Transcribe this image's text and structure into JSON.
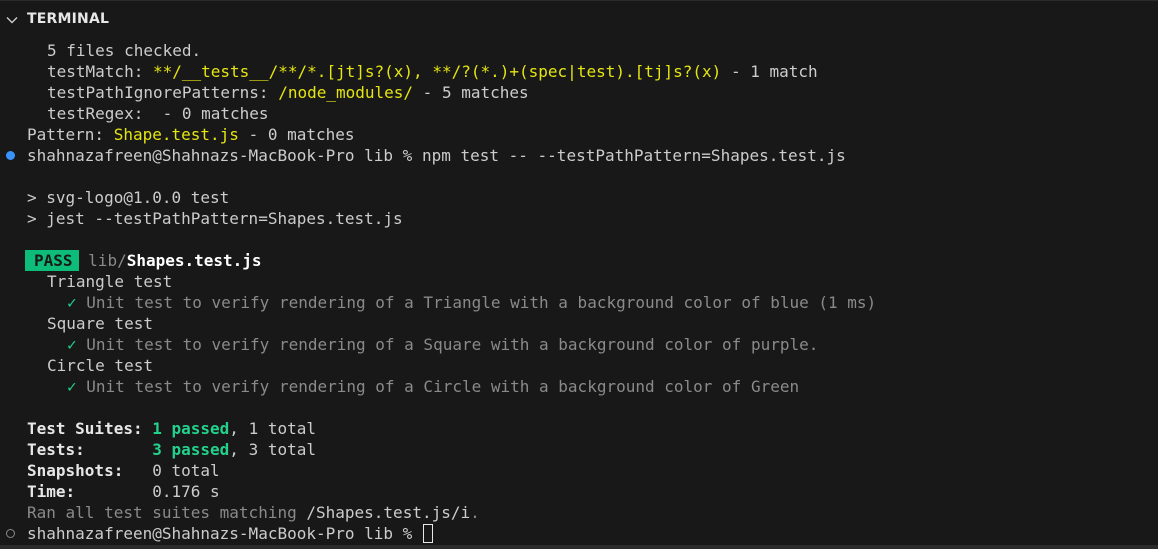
{
  "panel": {
    "title": "TERMINAL",
    "collapse_icon": "chevron-down-icon"
  },
  "colors": {
    "background": "#181818",
    "text": "#cccccc",
    "yellow": "#e5e510",
    "green": "#23d18b",
    "pass_bg": "#0dbc79",
    "dim": "#8a8a8a",
    "dot_blue": "#3794ff"
  },
  "lines": {
    "files_checked": "5 files checked.",
    "test_match_label": "testMatch: ",
    "test_match_value": "**/__tests__/**/*.[jt]s?(x), **/?(*.)+(spec|test).[tj]s?(x)",
    "test_match_suffix": " - 1 match",
    "ignore_label": "testPathIgnorePatterns: ",
    "ignore_value": "/node_modules/",
    "ignore_suffix": " - 5 matches",
    "regex_line": "testRegex:  - 0 matches",
    "pattern_label": "Pattern: ",
    "pattern_value": "Shape.test.js",
    "pattern_suffix": " - 0 matches",
    "prompt_1": "shahnazafreen@Shahnazs-MacBook-Pro lib % npm test -- --testPathPattern=Shapes.test.js",
    "npm_run": "> svg-logo@1.0.0 test",
    "jest_cmd": "> jest --testPathPattern=Shapes.test.js",
    "pass_badge": "PASS",
    "pass_dir": "lib/",
    "pass_file": "Shapes.test.js",
    "suite_triangle": "Triangle test",
    "test_triangle": "Unit test to verify rendering of a Triangle with a background color of blue (1 ms)",
    "suite_square": "Square test",
    "test_square": "Unit test to verify rendering of a Square with a background color of purple.",
    "suite_circle": "Circle test",
    "test_circle": "Unit test to verify rendering of a Circle with a background color of Green",
    "check_glyph": "✓",
    "summary_suites_label": "Test Suites: ",
    "summary_suites_passed": "1 passed",
    "summary_suites_total": ", 1 total",
    "summary_tests_label": "Tests:       ",
    "summary_tests_passed": "3 passed",
    "summary_tests_total": ", 3 total",
    "summary_snapshots_label": "Snapshots:   ",
    "summary_snapshots_value": "0 total",
    "summary_time_label": "Time:        ",
    "summary_time_value": "0.176 s",
    "ran_all_prefix": "Ran all test suites matching ",
    "ran_all_pattern": "/Shapes.test.js/i",
    "ran_all_suffix": ".",
    "prompt_2": "shahnazafreen@Shahnazs-MacBook-Pro lib % "
  }
}
